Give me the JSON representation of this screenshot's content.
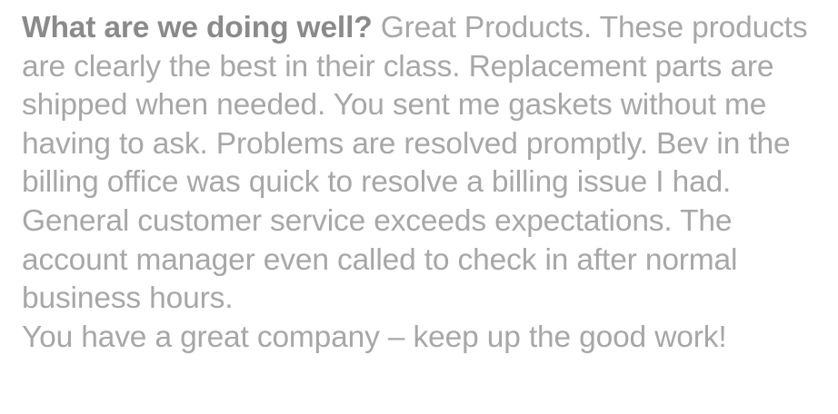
{
  "feedback": {
    "question": "What are we doing well?",
    "answer": "Great Products. These products are clearly the best in their class. Replacement parts are shipped when needed. You sent me gaskets without me having to ask. Problems are resolved promptly. Bev in the billing office was quick to resolve a billing issue I had. General customer service exceeds expectations. The account manager even called to check in after normal business hours.",
    "closing": "You have a great company – keep up the good work!"
  },
  "colors": {
    "question_text": "#8a8a8a",
    "body_text": "#a7a7a7",
    "background": "#ffffff"
  }
}
